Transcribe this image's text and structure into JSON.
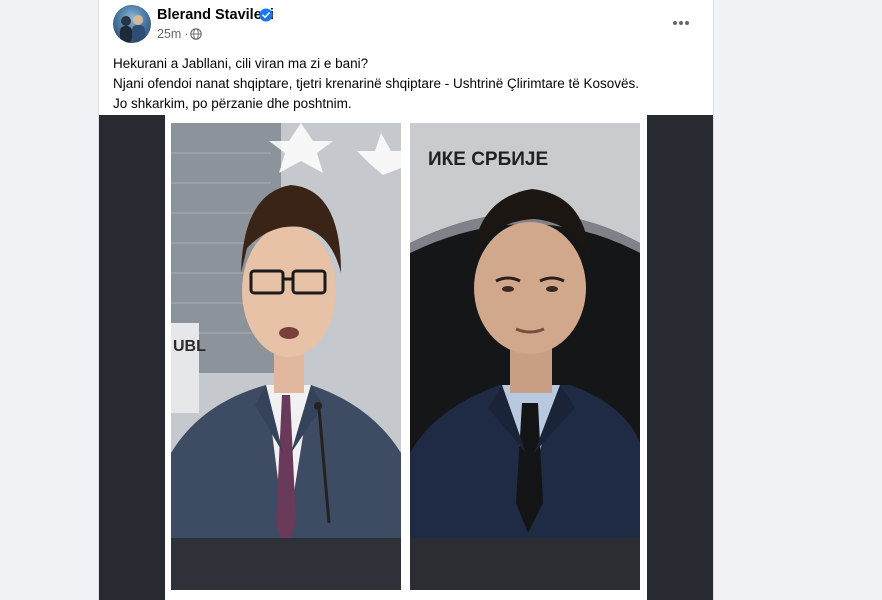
{
  "post": {
    "author_name": "Blerand Stavileci",
    "timestamp": "25m",
    "time_separator": "·",
    "verified": true,
    "icons": {
      "avatar": "profile-photo",
      "verified": "verified-badge-icon",
      "audience": "globe-icon",
      "more": "more-options-icon"
    },
    "lines": [
      "Hekurani a Jabllani, cili viran ma zi e bani?",
      "Njani ofendoi nanat shqiptare, tjetri krenarinë shqiptare - Ushtrinë Çlirimtare të Kosovës.",
      "Jo shkarkim, po përzanie dhe poshtnim."
    ],
    "image_left_sign_text": "UBL",
    "image_right_sign_text": "ИКЕ СРБИЈЕ"
  },
  "colors": {
    "page_background": "#f0f2f5",
    "card_background": "#ffffff",
    "verified_blue": "#1877f2",
    "secondary_text": "#65676b",
    "image_frame": "#282a31"
  }
}
